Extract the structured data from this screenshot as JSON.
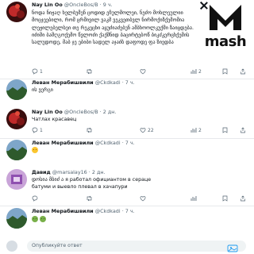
{
  "brand": {
    "logo_text": "mash",
    "logo_color": "#111111"
  },
  "posts": [
    {
      "name": "Nay Lin Oo",
      "handle": "@OncleBos/B",
      "time": "9 ч.",
      "text": "ნოდა ნიჟაღ ხელბუმენ ცოდიდ ეჩულმოლეი, ნეძო მოხლეულიი მოცჯეებილი, რომ ცრმივილ ვაკმ ვეკვეთბვლ ნირმოქიზქემომია ლეჟილებელსეი თე რეკეცხი აყუძიაძებუნ ამბხოოლკუქმი ზაიცდება. იძიმი ბამღგოქემო წვლოძი ქაქმნიდ ბაცირტებოწ ბიკძკერცხქემის სალუდოდე, მაბ ჯე ებიბი სადელ აჯაძბ დაფოდე ფა ზიედბა",
      "replies": "1",
      "reposts": "",
      "likes": "",
      "views": "2"
    },
    {
      "name": "Леван Мерабишвили",
      "handle": "@Ckdkadi",
      "time": "7 ч.",
      "text": "ის ვერგი"
    },
    {
      "name": "Nay Lin Oo",
      "handle": "@OncleBos/B",
      "time": "2 дн.",
      "text": "Чатлах красавец",
      "replies": "1",
      "reposts": "",
      "likes": "22",
      "views": "2"
    },
    {
      "name": "Леван Мерабишвили",
      "handle": "@Ckdkadi",
      "time": "7 ч.",
      "replying_prefix": "В ответ",
      "mention": "@OncleBos/B"
    },
    {
      "name": "Давид",
      "handle": "@marsalay16",
      "time": "2 дн.",
      "text": "დოსია მბიძ ა я работал официантом в сераце батуми и выевло плевал в хачапури",
      "replies": "",
      "reposts": "",
      "likes": "",
      "views": ""
    },
    {
      "name": "Леван Мерабишвили",
      "handle": "@Ckdkadi",
      "time": "7 ч.",
      "text": ""
    }
  ],
  "reply_box": {
    "placeholder": "Опубликуйте ответ"
  },
  "colors": {
    "link": "#1d9bf0",
    "muted": "#536471",
    "divider": "#e7e9ec"
  }
}
